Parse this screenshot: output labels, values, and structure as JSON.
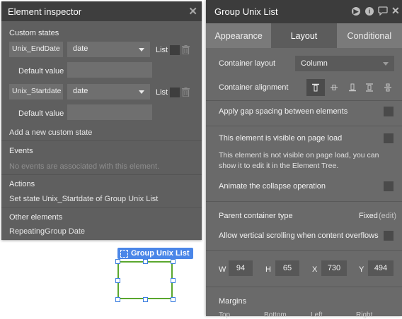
{
  "inspector": {
    "title": "Element inspector",
    "custom_states_heading": "Custom states",
    "states": [
      {
        "name": "Unix_EndDate",
        "type": "date",
        "list_label": "List",
        "default_label": "Default value",
        "default_value": ""
      },
      {
        "name": "Unix_Startdate",
        "type": "date",
        "list_label": "List",
        "default_label": "Default value",
        "default_value": ""
      }
    ],
    "add_state_link": "Add a new custom state",
    "events_heading": "Events",
    "events_empty": "No events are associated with this element.",
    "actions_heading": "Actions",
    "actions_item": "Set state Unix_Startdate of Group Unix List",
    "other_heading": "Other elements",
    "other_item": "RepeatingGroup Date"
  },
  "canvas": {
    "selected_label": "Group Unix List"
  },
  "property_editor": {
    "title": "Group Unix List",
    "header_icons": [
      "play-icon",
      "info-icon",
      "comment-icon",
      "close-icon"
    ],
    "tabs": [
      "Appearance",
      "Layout",
      "Conditional"
    ],
    "active_tab": "Layout",
    "container_layout_label": "Container layout",
    "container_layout_value": "Column",
    "container_alignment_label": "Container alignment",
    "gap_label": "Apply gap spacing between elements",
    "visible_label": "This element is visible on page load",
    "visible_note_1": "This element is not visible on page load, you can",
    "visible_note_2": "show it to edit it in the Element Tree.",
    "animate_label": "Animate the collapse operation",
    "parent_type_label": "Parent container type",
    "parent_type_value": "Fixed",
    "parent_type_edit": "(edit)",
    "scroll_label": "Allow vertical scrolling when content overflows",
    "dims": {
      "w_label": "W",
      "w": "94",
      "h_label": "H",
      "h": "65",
      "x_label": "X",
      "x": "730",
      "y_label": "Y",
      "y": "494"
    },
    "margins_label": "Margins",
    "margin_cols": [
      "Top",
      "Bottom",
      "Left",
      "Right"
    ]
  },
  "colors": {
    "accent_blue": "#4a86e8",
    "selection_green": "#5aa72e",
    "panel": "#5f5f5f"
  }
}
